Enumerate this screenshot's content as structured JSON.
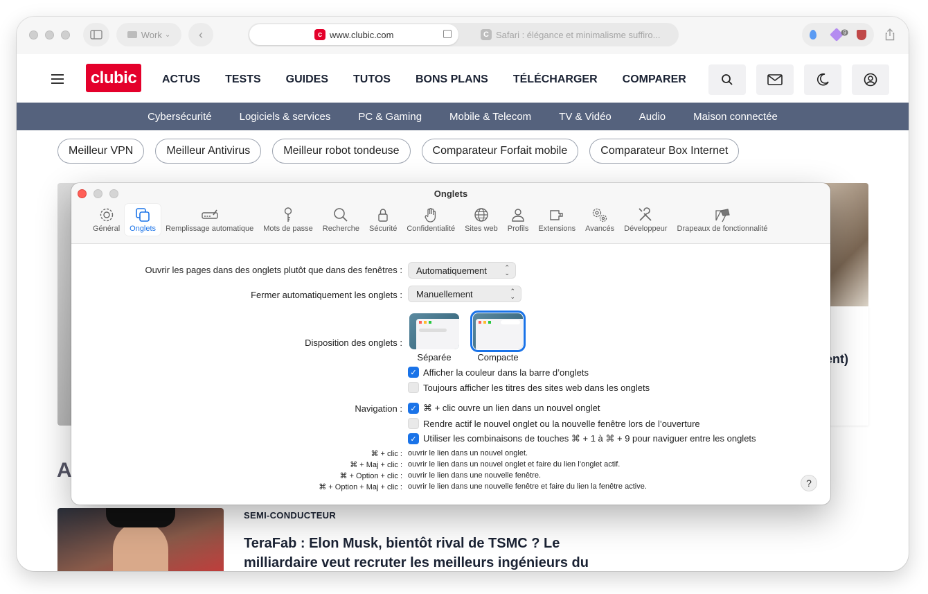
{
  "browser": {
    "profile_label": "Work",
    "active_tab": {
      "favicon_letter": "c",
      "url": "www.clubic.com"
    },
    "other_tab": {
      "favicon_letter": "C",
      "title": "Safari : élégance et minimalisme suffiro..."
    },
    "extension_badge": "9"
  },
  "site": {
    "logo_text": "clubic",
    "nav": [
      "ACTUS",
      "TESTS",
      "GUIDES",
      "TUTOS",
      "BONS PLANS",
      "TÉLÉCHARGER",
      "COMPARER"
    ],
    "categories": [
      "Cybersécurité",
      "Logiciels & services",
      "PC & Gaming",
      "Mobile & Telecom",
      "TV & Vidéo",
      "Audio",
      "Maison connectée"
    ],
    "chips": [
      "Meilleur VPN",
      "Meilleur Antivirus",
      "Meilleur robot tondeuse",
      "Comparateur Forfait mobile",
      "Comparateur Box Internet"
    ],
    "hero_snippet": "ent)",
    "section_letter": "A",
    "article": {
      "category": "SEMI-CONDUCTEUR",
      "title": "TeraFab : Elon Musk, bientôt rival de TSMC ? Le milliardaire veut recruter les meilleurs ingénieurs du"
    }
  },
  "prefs": {
    "title": "Onglets",
    "tabs": [
      {
        "label": "Général",
        "icon": "gear-icon"
      },
      {
        "label": "Onglets",
        "icon": "tabs-icon"
      },
      {
        "label": "Remplissage automatique",
        "icon": "autofill-icon"
      },
      {
        "label": "Mots de passe",
        "icon": "key-icon"
      },
      {
        "label": "Recherche",
        "icon": "search-icon"
      },
      {
        "label": "Sécurité",
        "icon": "lock-icon"
      },
      {
        "label": "Confidentialité",
        "icon": "hand-icon"
      },
      {
        "label": "Sites web",
        "icon": "globe-icon"
      },
      {
        "label": "Profils",
        "icon": "person-icon"
      },
      {
        "label": "Extensions",
        "icon": "puzzle-icon"
      },
      {
        "label": "Avancés",
        "icon": "gears-icon"
      },
      {
        "label": "Développeur",
        "icon": "tools-icon"
      },
      {
        "label": "Drapeaux de fonctionnalité",
        "icon": "flags-icon"
      }
    ],
    "open_pages": {
      "label": "Ouvrir les pages dans des onglets plutôt que dans des fenêtres :",
      "value": "Automatiquement"
    },
    "auto_close": {
      "label": "Fermer automatiquement les onglets :",
      "value": "Manuellement"
    },
    "layout": {
      "label": "Disposition des onglets :",
      "options": [
        "Séparée",
        "Compacte"
      ],
      "selected": "Compacte"
    },
    "checkboxes_layout": [
      {
        "label": "Afficher la couleur dans la barre d’onglets",
        "checked": true
      },
      {
        "label": "Toujours afficher les titres des sites web dans les onglets",
        "checked": false
      }
    ],
    "navigation_label": "Navigation :",
    "checkboxes_nav": [
      {
        "label": "⌘ + clic ouvre un lien dans un nouvel onglet",
        "checked": true
      },
      {
        "label": "Rendre actif le nouvel onglet ou la nouvelle fenêtre lors de l’ouverture",
        "checked": false
      },
      {
        "label": "Utiliser les combinaisons de touches ⌘ + 1 à ⌘ + 9 pour naviguer entre les onglets",
        "checked": true
      }
    ],
    "shortcuts": [
      {
        "keys": "⌘ + clic :",
        "desc": "ouvrir le lien dans un nouvel onglet."
      },
      {
        "keys": "⌘ + Maj + clic :",
        "desc": "ouvrir le lien dans un nouvel onglet et faire du lien l’onglet actif."
      },
      {
        "keys": "⌘ + Option + clic :",
        "desc": "ouvrir le lien dans une nouvelle fenêtre."
      },
      {
        "keys": "⌘ + Option + Maj + clic :",
        "desc": "ouvrir le lien dans une nouvelle fenêtre et faire du lien la fenêtre active."
      }
    ],
    "help_label": "?"
  }
}
